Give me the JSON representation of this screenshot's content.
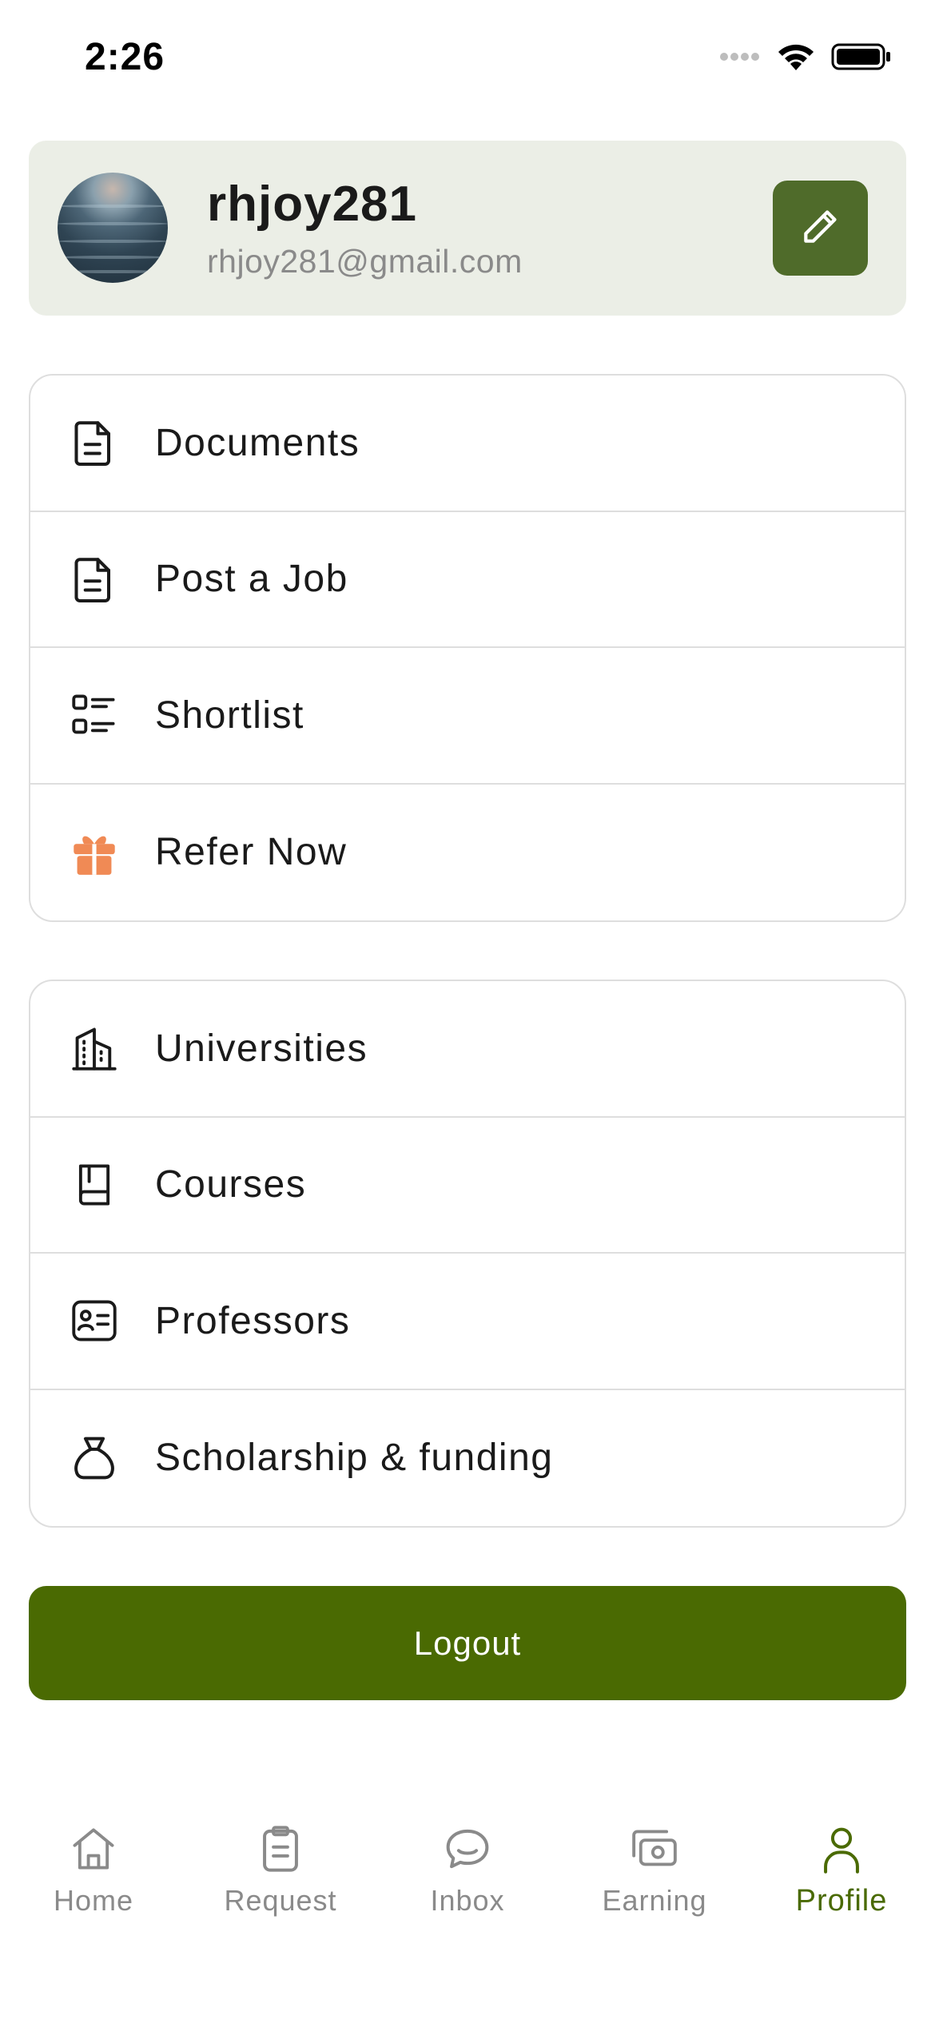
{
  "status_bar": {
    "time": "2:26"
  },
  "profile": {
    "username": "rhjoy281",
    "email": "rhjoy281@gmail.com"
  },
  "menu_group_1": [
    {
      "label": "Documents",
      "icon": "document-icon"
    },
    {
      "label": "Post a Job",
      "icon": "document-icon"
    },
    {
      "label": "Shortlist",
      "icon": "list-icon"
    },
    {
      "label": "Refer Now",
      "icon": "gift-icon"
    }
  ],
  "menu_group_2": [
    {
      "label": "Universities",
      "icon": "building-icon"
    },
    {
      "label": "Courses",
      "icon": "book-icon"
    },
    {
      "label": "Professors",
      "icon": "id-card-icon"
    },
    {
      "label": "Scholarship & funding",
      "icon": "money-bag-icon"
    }
  ],
  "logout_label": "Logout",
  "bottom_nav": [
    {
      "label": "Home",
      "icon": "home-icon",
      "active": false
    },
    {
      "label": "Request",
      "icon": "clipboard-icon",
      "active": false
    },
    {
      "label": "Inbox",
      "icon": "chat-icon",
      "active": false
    },
    {
      "label": "Earning",
      "icon": "cash-icon",
      "active": false
    },
    {
      "label": "Profile",
      "icon": "user-icon",
      "active": true
    }
  ],
  "colors": {
    "accent": "#4a6a02",
    "edit_button": "#4f6b2a",
    "profile_card_bg": "#ebeee6",
    "gift_icon": "#f08a55",
    "inactive_nav": "#8a8a8a"
  }
}
